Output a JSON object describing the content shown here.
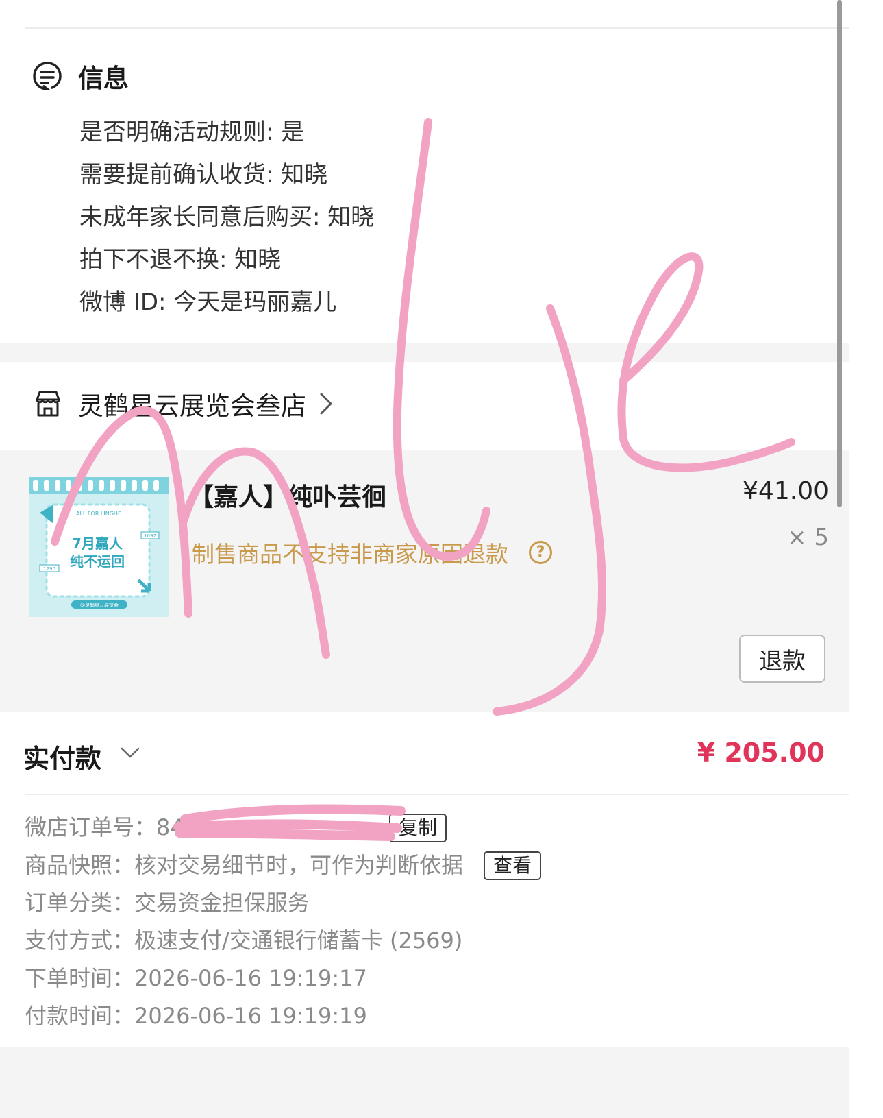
{
  "info_section": {
    "title": "信息",
    "lines": [
      "是否明确活动规则: 是",
      "需要提前确认收货: 知晓",
      "未成年家长同意后购买: 知晓",
      "拍下不退不换: 知晓",
      "微博 ID: 今天是玛丽嘉儿"
    ]
  },
  "shop": {
    "name": "灵鹤星云展览会叁店"
  },
  "product": {
    "title": "【嘉人】纯卟芸徊",
    "price": "¥41.00",
    "quantity": "× 5",
    "policy": "制售商品不支持非商家原因退款",
    "help_symbol": "?",
    "thumb_lines": [
      "ALL FOR LINGHE",
      "7月嘉人",
      "纯不运回",
      "1097",
      "1290",
      "@灵鹤星云展览会"
    ],
    "refund_button": "退款"
  },
  "payment": {
    "label": "实付款",
    "amount": "¥ 205.00"
  },
  "order_details": {
    "order_no_label": "微店订单号：",
    "order_no_value": "84",
    "copy_button": "复制",
    "snapshot_label": "商品快照：",
    "snapshot_value": "核对交易细节时，可作为判断依据",
    "view_button": "查看",
    "category_label": "订单分类：",
    "category_value": "交易资金担保服务",
    "pay_method_label": "支付方式：",
    "pay_method_value": "极速支付/交通银行储蓄卡 (2569)",
    "order_time_label": "下单时间：",
    "order_time_value": "2026-06-16 19:19:17",
    "pay_time_label": "付款时间：",
    "pay_time_value": "2026-06-16 19:19:19"
  },
  "colors": {
    "accent_red": "#e0345a",
    "policy_gold": "#c99a4c",
    "scribble_pink": "#f2a3c4",
    "band_gray": "#f4f4f4"
  }
}
